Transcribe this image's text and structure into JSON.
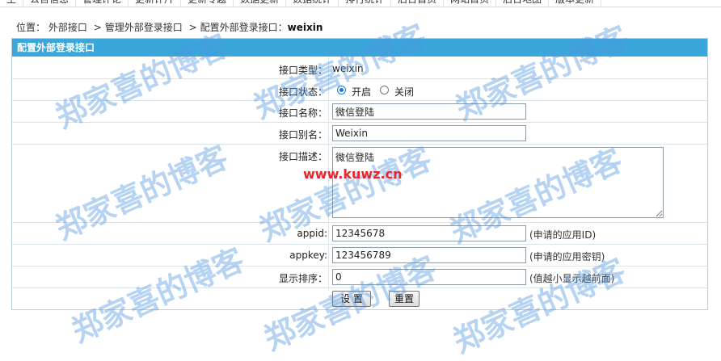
{
  "top_menu": [
    "主",
    "公告信息",
    "管理评论",
    "更新评片",
    "更新专题",
    "数据更新",
    "数据统计",
    "排行统计",
    "后台首页",
    "网站首页",
    "后台地图",
    "版本更新"
  ],
  "breadcrumb": {
    "prefix": "位置：",
    "items": [
      "外部接口",
      "管理外部登录接口",
      "配置外部登录接口："
    ],
    "current": "weixin",
    "separator": ">"
  },
  "panel": {
    "title": "配置外部登录接口",
    "fields": {
      "type": {
        "label": "接口类型：",
        "value": "weixin"
      },
      "status": {
        "label": "接口状态：",
        "options": [
          "开启",
          "关闭"
        ],
        "selected": "开启"
      },
      "name": {
        "label": "接口名称：",
        "value": "微信登陆"
      },
      "alias": {
        "label": "接口别名：",
        "value": "Weixin"
      },
      "desc": {
        "label": "接口描述：",
        "value": "微信登陆"
      },
      "appid": {
        "label": "appid:",
        "value": "12345678",
        "hint": "(申请的应用ID)"
      },
      "appkey": {
        "label": "appkey:",
        "value": "123456789",
        "hint": "(申请的应用密钥)"
      },
      "order": {
        "label": "显示排序：",
        "value": "0",
        "hint": "(值越小显示越前面)"
      }
    },
    "buttons": {
      "submit": "设 置",
      "reset": "重置"
    }
  },
  "watermark": {
    "text": "郑家喜的博客",
    "site": "www.kuwz.cn"
  }
}
